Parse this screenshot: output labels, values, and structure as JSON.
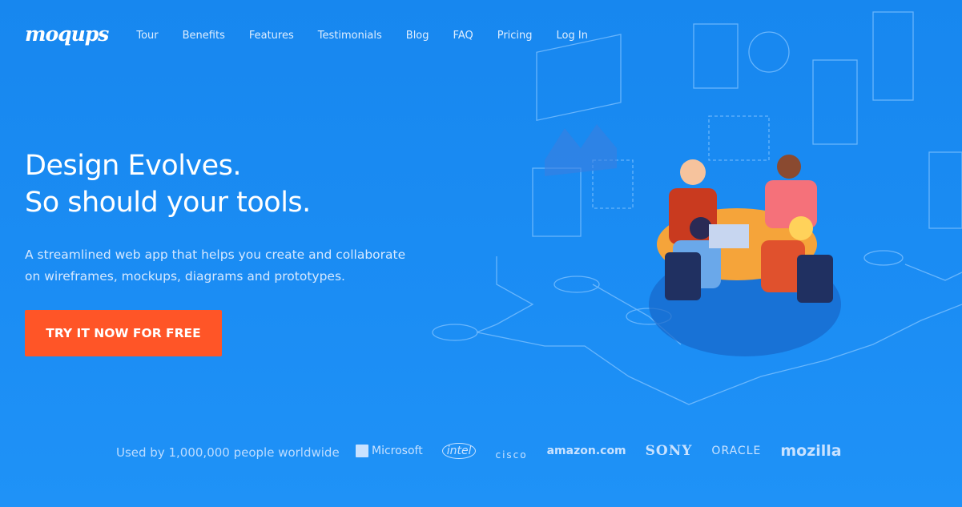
{
  "nav": {
    "logo": "moqups",
    "items": [
      "Tour",
      "Benefits",
      "Features",
      "Testimonials",
      "Blog",
      "FAQ",
      "Pricing",
      "Log In"
    ]
  },
  "hero": {
    "title_line1": "Design Evolves.",
    "title_line2": "So should your tools.",
    "subtitle": "A streamlined web app that helps you create and collaborate on wireframes, mockups, diagrams and prototypes.",
    "cta": "TRY IT NOW FOR FREE"
  },
  "social_proof": {
    "text": "Used by 1,000,000 people worldwide",
    "logos": [
      "Microsoft",
      "intel",
      "cisco",
      "amazon.com",
      "SONY",
      "ORACLE",
      "mozilla"
    ]
  },
  "colors": {
    "background": "#1a8af2",
    "cta": "#ff5527"
  }
}
